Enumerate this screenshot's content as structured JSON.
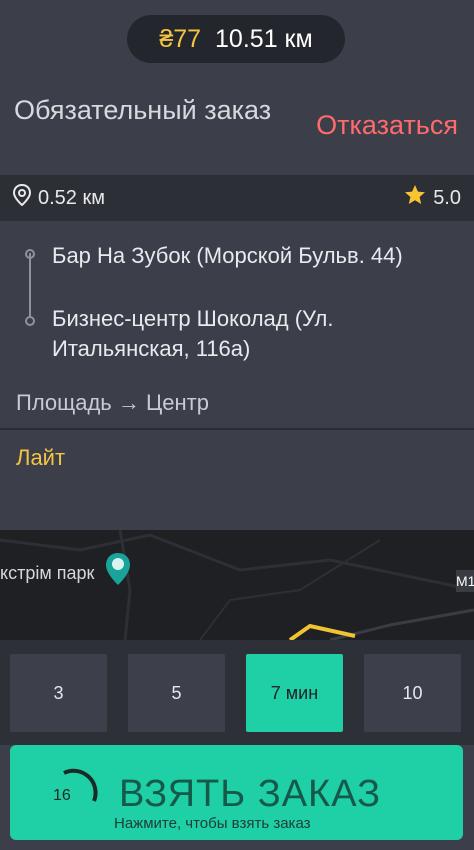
{
  "header": {
    "price": "₴77",
    "distance": "10.51 км"
  },
  "order": {
    "title": "Обязательный заказ",
    "decline_label": "Отказаться"
  },
  "info": {
    "pickup_distance": "0.52 км",
    "rating": "5.0"
  },
  "route": {
    "from": "Бар На Зубок (Морской Бульв. 44)",
    "to": "Бизнес-центр Шоколад (Ул. Итальянская, 116а)",
    "area": "Площадь → Центр"
  },
  "tariff": "Лайт",
  "map": {
    "poi_label": "кстрім парк",
    "road_badge": "M1"
  },
  "time_options": [
    {
      "label": "3",
      "selected": false
    },
    {
      "label": "5",
      "selected": false
    },
    {
      "label": "7 мин",
      "selected": true
    },
    {
      "label": "10",
      "selected": false
    }
  ],
  "take_order": {
    "countdown": "16",
    "label": "ВЗЯТЬ ЗАКАЗ",
    "hint": "Нажмите, чтобы взять заказ"
  },
  "colors": {
    "accent": "#1fcfa6",
    "price": "#f4c542",
    "decline": "#ff6b6b"
  }
}
